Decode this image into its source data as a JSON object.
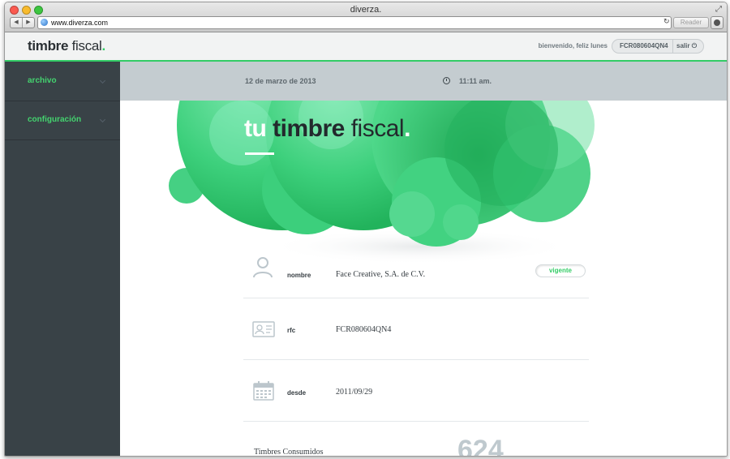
{
  "browser": {
    "window_title": "diverza.",
    "url": "www.diverza.com",
    "reader_label": "Reader"
  },
  "header": {
    "logo_bold": "timbre",
    "logo_light": "fiscal",
    "logo_dot": ".",
    "welcome": "bienvenido, feliz lunes",
    "user_code": "FCR080604QN4",
    "logout_label": "salir"
  },
  "sidebar": {
    "items": [
      {
        "label": "archivo"
      },
      {
        "label": "configuración"
      }
    ]
  },
  "infobar": {
    "date": "12 de marzo de 2013",
    "time": "11:11 am."
  },
  "hero": {
    "tu": "tu",
    "timbre": "timbre",
    "fiscal": "fiscal",
    "dot": "."
  },
  "details": {
    "name_label": "nombre",
    "name_value": "Face Creative, S.A. de C.V.",
    "status": "vigente",
    "rfc_label": "rfc",
    "rfc_value": "FCR080604QN4",
    "since_label": "desde",
    "since_value": "2011/09/29",
    "consumed_label": "Timbres Consumidos",
    "consumed_value": "624"
  },
  "colors": {
    "accent": "#33cc66",
    "sidebar": "#394247",
    "infobar": "#c4ccd0"
  }
}
